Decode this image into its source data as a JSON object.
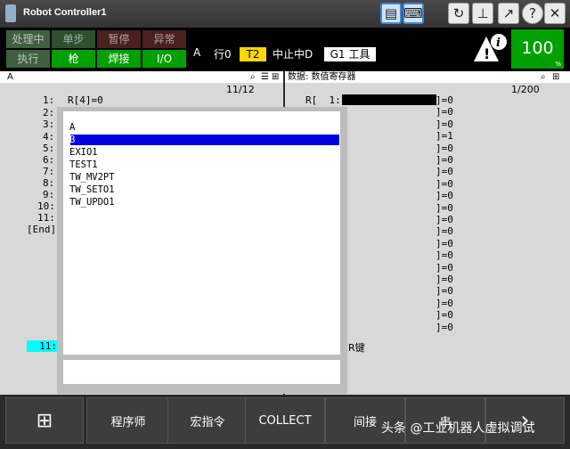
{
  "window": {
    "title": "Robot Controller1"
  },
  "status": {
    "leds": [
      "处理中",
      "单步",
      "暂停",
      "异常",
      "执行",
      "枪",
      "焊接",
      "I/O"
    ],
    "prog": "A",
    "line_label": "行0",
    "mode": "T2",
    "state": "中止中D",
    "frame": "G1 工具",
    "speed": "100",
    "speed_unit": "%"
  },
  "left": {
    "header": "A",
    "pos": "11/12",
    "lines": [
      "1:",
      "2:",
      "3:",
      "4:",
      "5:",
      "6:",
      "7:",
      "8:",
      "9:",
      "10:",
      "11:",
      "[End]"
    ],
    "line1_code": "R[4]=0",
    "current_line": "11:"
  },
  "right": {
    "header": "数据: 数值寄存器",
    "pos": "1/200",
    "row1_prefix": "R[  1:",
    "values": [
      "]=0",
      "]=0",
      "]=0",
      "]=1",
      "]=0",
      "]=0",
      "]=0",
      "]=0",
      "]=0",
      "]=0",
      "]=0",
      "]=0",
      "]=0",
      "]=0",
      "]=0",
      "]=0",
      "]=0",
      "]=0",
      "]=0",
      "]=0"
    ],
    "prompt": "ER键"
  },
  "popup": {
    "items": [
      "A",
      "B",
      "EXIO1",
      "TEST1",
      "TW_MV2PT",
      "TW_SETO1",
      "TW_UPDO1"
    ],
    "selected": "B"
  },
  "footer": {
    "buttons": [
      "程序师",
      "宏指令",
      "COLLECT",
      "间接",
      "串"
    ],
    "grid_icon": "⊞",
    "next_icon": "›",
    "watermark": "头条 @工业机器人虚拟调试"
  }
}
